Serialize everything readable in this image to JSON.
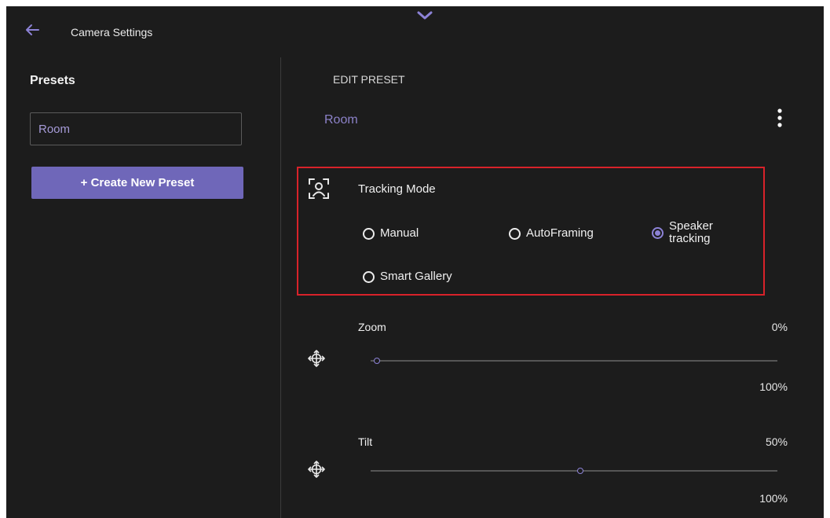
{
  "header": {
    "title": "Camera Settings",
    "back_icon": "arrow-left-icon",
    "collapse_icon": "chevron-down-icon"
  },
  "sidebar": {
    "title": "Presets",
    "presets": [
      {
        "label": "Room"
      }
    ],
    "create_button_label": "+ Create New Preset"
  },
  "main": {
    "section_title": "EDIT PRESET",
    "preset_name": "Room",
    "more_icon": "more-vertical-icon",
    "tracking": {
      "label": "Tracking Mode",
      "icon": "person-frame-icon",
      "options": [
        {
          "label": "Manual",
          "checked": false
        },
        {
          "label": "AutoFraming",
          "checked": false
        },
        {
          "label": "Speaker tracking",
          "checked": true
        },
        {
          "label": "Smart Gallery",
          "checked": false
        }
      ]
    },
    "sliders": [
      {
        "label": "Zoom",
        "value": "0%",
        "max_label": "100%",
        "fraction": 0.0,
        "icon": "move-arrows-icon"
      },
      {
        "label": "Tilt",
        "value": "50%",
        "max_label": "100%",
        "fraction": 0.5,
        "icon": "move-arrows-icon"
      }
    ]
  },
  "colors": {
    "accent": "#6f67b9",
    "accent_light": "#8c82d6",
    "highlight": "#d8222a",
    "background": "#1c1c1c"
  }
}
